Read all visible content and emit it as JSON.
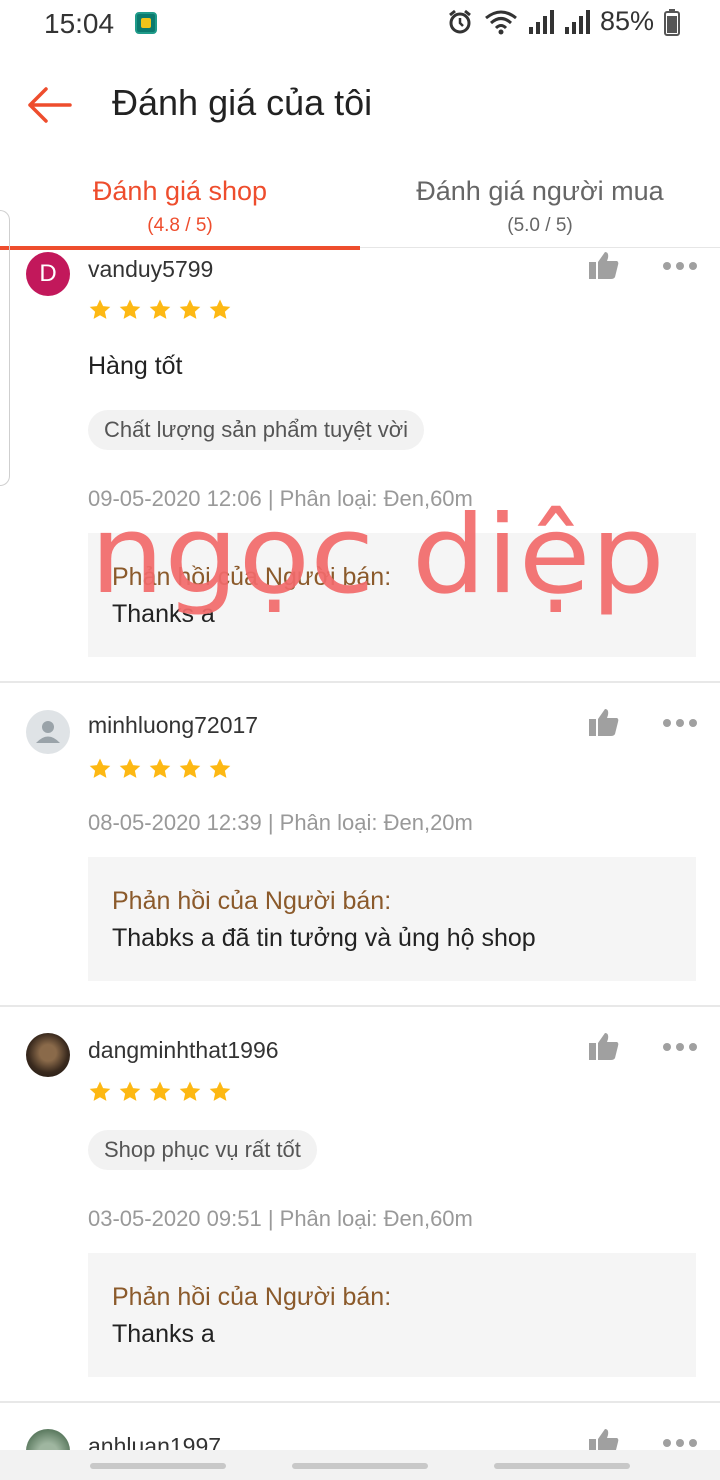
{
  "status_bar": {
    "time": "15:04",
    "battery": "85%"
  },
  "header": {
    "title": "Đánh giá của tôi"
  },
  "tabs": [
    {
      "label": "Đánh giá shop",
      "sub": "(4.8 / 5)",
      "active": true
    },
    {
      "label": "Đánh giá người mua",
      "sub": "(5.0 / 5)",
      "active": false
    }
  ],
  "colors": {
    "accent": "#ee4d2d",
    "star": "#fdb813",
    "reply_title": "#8b5a2b"
  },
  "watermark": "ngọc diệp",
  "reviews": [
    {
      "username": "vanduy5799",
      "avatar_letter": "D",
      "rating": 5,
      "comment": "Hàng tốt",
      "tag": "Chất lượng sản phẩm tuyệt vời",
      "meta": "09-05-2020 12:06 | Phân loại: Đen,60m",
      "reply_title": "Phản hồi của Người bán:",
      "reply": "Thanks a"
    },
    {
      "username": "minhluong72017",
      "rating": 5,
      "meta": "08-05-2020 12:39 | Phân loại: Đen,20m",
      "reply_title": "Phản hồi của Người bán:",
      "reply": "Thabks a đã tin tưởng và ủng hộ shop"
    },
    {
      "username": "dangminhthat1996",
      "rating": 5,
      "tag": "Shop phục vụ rất tốt",
      "meta": "03-05-2020 09:51 | Phân loại: Đen,60m",
      "reply_title": "Phản hồi của Người bán:",
      "reply": "Thanks a"
    },
    {
      "username": "anhluan1997"
    }
  ]
}
